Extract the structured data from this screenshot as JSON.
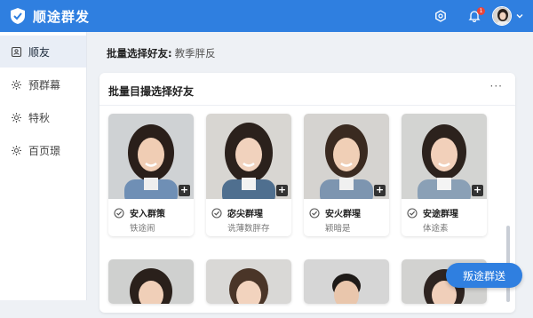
{
  "app": {
    "title": "顺途群发"
  },
  "header": {
    "notification_count": "1"
  },
  "sidebar": {
    "items": [
      {
        "label": "顺友",
        "active": true
      },
      {
        "label": "预群幕"
      },
      {
        "label": "特秋"
      },
      {
        "label": "百页璟"
      }
    ]
  },
  "breadcrumb": {
    "label": "批量选择好友:",
    "sub": "教季胖反"
  },
  "panel": {
    "title": "批量目撮选择好友",
    "more": "···"
  },
  "friends": [
    {
      "name": "安入群策",
      "sub": "铁途闹"
    },
    {
      "name": "宓尖群瑆",
      "sub": "诜薄数胖存"
    },
    {
      "name": "安火群瑆",
      "sub": "颖暗是"
    },
    {
      "name": "安途群瑆",
      "sub": "体途素"
    }
  ],
  "fab": {
    "label": "叛途群送"
  },
  "colors": {
    "accent": "#2f7fe0",
    "sidebar_active": "#e9eef6"
  }
}
